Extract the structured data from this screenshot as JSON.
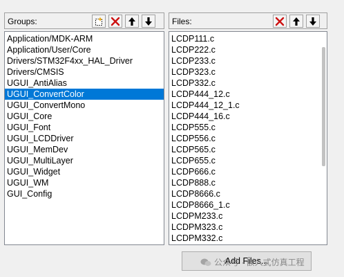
{
  "groups": {
    "title": "Groups:",
    "items": [
      "Application/MDK-ARM",
      "Application/User/Core",
      "Drivers/STM32F4xx_HAL_Driver",
      "Drivers/CMSIS",
      "UGUI_AntiAlias",
      "UGUI_ConvertColor",
      "UGUI_ConvertMono",
      "UGUI_Core",
      "UGUI_Font",
      "UGUI_LCDDriver",
      "UGUI_MemDev",
      "UGUI_MultiLayer",
      "UGUI_Widget",
      "UGUI_WM",
      "GUI_Config"
    ],
    "selected_index": 5
  },
  "files": {
    "title": "Files:",
    "items": [
      "LCDP111.c",
      "LCDP222.c",
      "LCDP233.c",
      "LCDP323.c",
      "LCDP332.c",
      "LCDP444_12.c",
      "LCDP444_12_1.c",
      "LCDP444_16.c",
      "LCDP555.c",
      "LCDP556.c",
      "LCDP565.c",
      "LCDP655.c",
      "LCDP666.c",
      "LCDP888.c",
      "LCDP8666.c",
      "LCDP8666_1.c",
      "LCDPM233.c",
      "LCDPM323.c",
      "LCDPM332.c"
    ]
  },
  "buttons": {
    "add_files": "Add Files..."
  },
  "watermark": {
    "text": "公众号 · 嵌入式仿真工程"
  },
  "icons": {
    "new": "new-group-icon",
    "delete": "delete-icon",
    "up": "move-up-icon",
    "down": "move-down-icon"
  },
  "colors": {
    "delete_red": "#cc1111",
    "selection": "#0078d7",
    "new_icon_accent": "#e8a000"
  }
}
